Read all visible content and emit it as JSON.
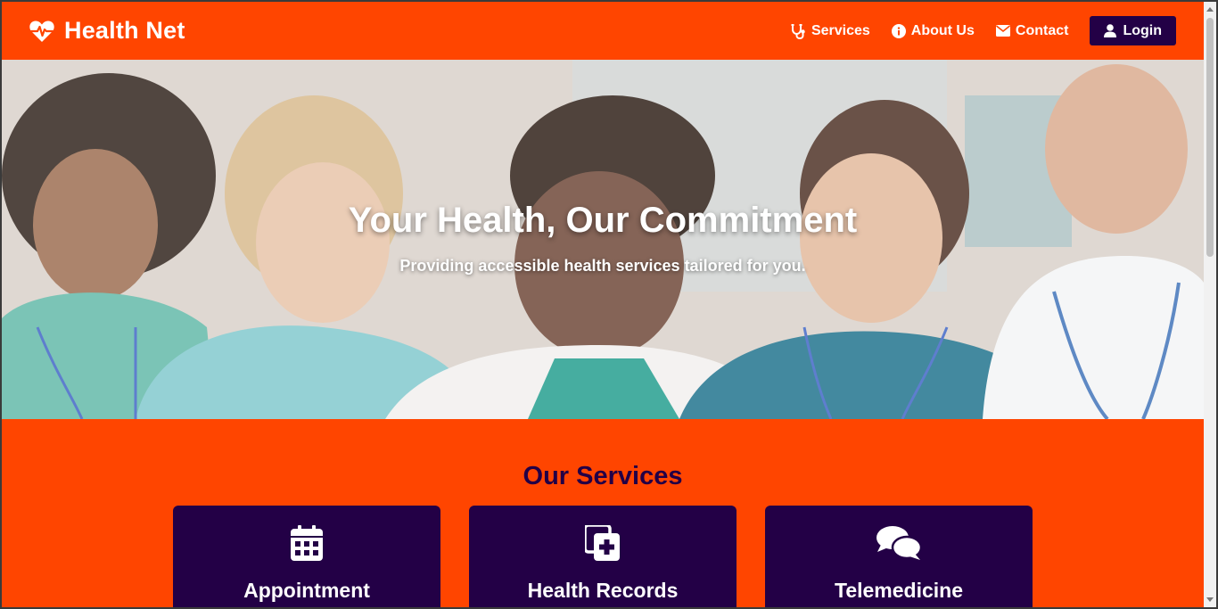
{
  "brand": {
    "title": "Health Net",
    "icon": "heartbeat-icon"
  },
  "nav": {
    "items": [
      {
        "label": "Services",
        "icon": "stethoscope-icon"
      },
      {
        "label": "About Us",
        "icon": "info-circle-icon"
      },
      {
        "label": "Contact",
        "icon": "envelope-icon"
      }
    ],
    "login": {
      "label": "Login",
      "icon": "user-icon"
    }
  },
  "hero": {
    "title": "Your Health, Our Commitment",
    "subtitle": "Providing accessible health services tailored for you."
  },
  "services": {
    "title": "Our Services",
    "cards": [
      {
        "title": "Appointment Scheduling",
        "icon": "calendar-icon"
      },
      {
        "title": "Health Records Management",
        "icon": "file-medical-icon"
      },
      {
        "title": "Telemedicine",
        "icon": "comments-icon"
      }
    ]
  },
  "colors": {
    "primary": "#ff4500",
    "dark": "#230046",
    "white": "#ffffff"
  }
}
